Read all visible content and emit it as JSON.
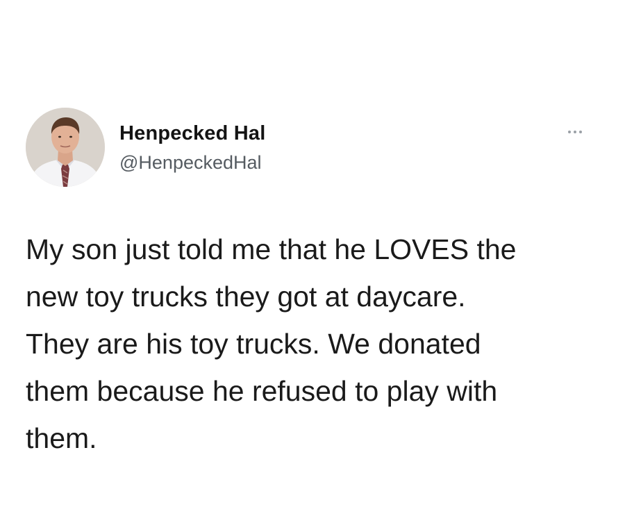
{
  "tweet": {
    "author": {
      "display_name": "Henpecked Hal",
      "handle": "@HenpeckedHal",
      "avatar_icon": "profile-photo-man-in-shirt-and-tie"
    },
    "more_icon": "ellipsis-icon",
    "text_lines": [
      "My son just told me that he LOVES the",
      "new toy trucks they got at daycare.",
      "They are his toy trucks. We donated",
      "them because he refused to play with",
      "them."
    ]
  }
}
